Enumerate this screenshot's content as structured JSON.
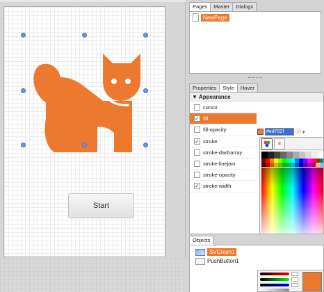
{
  "pages_panel": {
    "tabs": [
      {
        "label": "Pages",
        "active": true
      },
      {
        "label": "Master",
        "active": false
      },
      {
        "label": "Dialogs",
        "active": false
      }
    ],
    "pages": [
      {
        "label": "NewPage",
        "selected": true
      }
    ]
  },
  "style_panel": {
    "tabs": [
      {
        "label": "Properties",
        "active": false
      },
      {
        "label": "Style",
        "active": true
      },
      {
        "label": "Hover",
        "active": false
      }
    ],
    "section_title": "Appearance",
    "properties": [
      {
        "label": "cursor",
        "checked": false,
        "selected": false
      },
      {
        "label": "fill",
        "checked": true,
        "selected": true
      },
      {
        "label": "fill-opacity",
        "checked": false,
        "selected": false
      },
      {
        "label": "stroke",
        "checked": true,
        "selected": false
      },
      {
        "label": "stroke-dasharray",
        "checked": false,
        "selected": false
      },
      {
        "label": "stroke-linejoin",
        "checked": false,
        "selected": false
      },
      {
        "label": "stroke-opacity",
        "checked": false,
        "selected": false
      },
      {
        "label": "stroke-width",
        "checked": true,
        "selected": false
      }
    ],
    "fill_value": "#ed792f"
  },
  "objects_panel": {
    "tabs": [
      {
        "label": "Objects",
        "active": true
      }
    ],
    "items": [
      {
        "label": "SVGIcon1",
        "selected": true,
        "icon": "svg-object-icon"
      },
      {
        "label": "PushButton1",
        "selected": false,
        "icon": "button-object-icon"
      }
    ]
  },
  "canvas": {
    "button_label": "Start",
    "icon_name": "cat-icon",
    "icon_color": "#ed792f"
  },
  "colors": {
    "accent": "#ed792f",
    "selection_handle": "#6d95e0"
  }
}
